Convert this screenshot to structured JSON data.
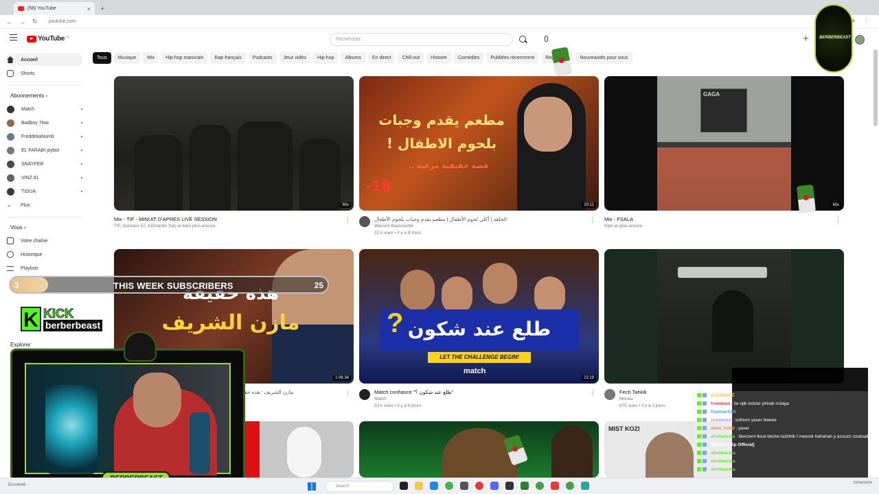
{
  "browser": {
    "tab_title": "(58) YouTube",
    "url": "youtube.com",
    "new_tab": "+",
    "tab_close": "×"
  },
  "header": {
    "logo_text": "YouTube",
    "logo_sup": "DZ",
    "search_placeholder": "Rechercher"
  },
  "chips": [
    "Tous",
    "Musique",
    "Mix",
    "Hip-hop marocain",
    "Rap français",
    "Podcasts",
    "Jeux vidéo",
    "Hip-hop",
    "Albums",
    "En direct",
    "Chill-out",
    "Histoire",
    "Comédies",
    "Publiées récemment",
    "Regardées",
    "Nouveautés pour vous"
  ],
  "sidebar": {
    "home": "Accueil",
    "shorts": "Shorts",
    "subs_heading": "Abonnements",
    "subs": [
      {
        "name": "Match",
        "color": "#333333"
      },
      {
        "name": "Badboy 7low",
        "color": "#8a6a4a"
      },
      {
        "name": "FreddeliaNumb",
        "color": "#6a7a8a"
      },
      {
        "name": "EL FARABI joyboi",
        "color": "#777777"
      },
      {
        "name": "SNAYFER",
        "color": "#4a4a4a"
      },
      {
        "name": "VINZ 81",
        "color": "#5a6a5a"
      },
      {
        "name": "TIDUA",
        "color": "#3a3a3a"
      }
    ],
    "more": "Plus",
    "you_heading": "Vous",
    "you_items": [
      "Votre chaîne",
      "Historique",
      "Playlists"
    ],
    "explore": "Explorer"
  },
  "videos": [
    {
      "title": "Mix - TIF - MINUIT D'APRES LIVE SESSION",
      "sub": "TIF, Gustavo 51, ElGrande Toto et bien plus encore",
      "meta": "",
      "duration": "Mix"
    },
    {
      "title": "الحلقة | أكلي لحوم الأطفال | مطعم يقدم وجبات بلحوم الأطفال",
      "sub": "Wassim Baccouche",
      "meta": "32 k vues • il y a 8 mois",
      "duration": "20:11"
    },
    {
      "title": "Mix - FSALA",
      "sub": "Klyb et plus encore",
      "meta": "",
      "duration": "Mix"
    },
    {
      "title": "مازن الشريف : هذه حقيقة",
      "sub": "",
      "meta": "",
      "duration": "1:06:34"
    },
    {
      "title": "Match confiance \"طلع عند شكون ؟\"",
      "sub": "Match",
      "meta": "33 k vues • il y a 6 jours",
      "duration": "23:19"
    },
    {
      "title": "Fech Tahkili",
      "sub": "Mouka",
      "meta": "675 vues • il y a 3 jours",
      "duration": ""
    }
  ],
  "thumb_text": {
    "t2_line1": "مطعم يقدم وجبات",
    "t2_line2": "بلحوم الاطفال !",
    "t2_line3": "قصة حقيقية مرعبة ..",
    "t2_rating": "-18",
    "t3_sign": "GAGA",
    "t4_line1": "هذه حقيقة",
    "t4_line2": "مازن الشريف",
    "t5_title": "طلع عند شكون",
    "t5_sub": "LET THE CHALLENGE BEGIN!",
    "t5_brand": "match",
    "t9_text": "MIST KOZI"
  },
  "overlay": {
    "sub_goal_label": "THIS WEEK SUBSCRIBERS",
    "sub_current": "3",
    "sub_target": "25",
    "sub_progress": 0.12,
    "kick_word": "KICK",
    "kick_user": "berberbeast",
    "cam_badge": "BERBERBEAST",
    "emblem_text": "BERBERBEAST"
  },
  "chat": [
    {
      "user": "AZZZOUZZ",
      "color": "#f5c542",
      "msg": ""
    },
    {
      "user": "fromtouu",
      "color": "#e04848",
      "msg": "tw njib indolsi ythrab m3ayа"
    },
    {
      "user": "Danmarki96",
      "color": "#4aa3ff",
      "msg": ""
    },
    {
      "user": "chebkoko",
      "color": "#b88cff",
      "msg": "sothom yaser 9weee"
    },
    {
      "user": "abdo_hmid",
      "color": "#ff8c3a",
      "msg": "yaser"
    },
    {
      "user": "almOoucha",
      "color": "#53fc18",
      "msg": "Benzerrt lkoul bèche ta3rthlk f meestir hahahah y azouzz roudoalk 3ala rouhk"
    },
    {
      "user": "Blanka [Clip Official]",
      "color": "#ffffff",
      "msg": ""
    },
    {
      "user": "almOouchu",
      "color": "#53fc18",
      "msg": ""
    },
    {
      "user": "almOouchu",
      "color": "#53fc18",
      "msg": ""
    },
    {
      "user": "almOouchu",
      "color": "#53fc18",
      "msg": ""
    }
  ],
  "taskbar": {
    "weather": "Ensoleillé",
    "search": "Search",
    "time": "22/09/2024"
  }
}
